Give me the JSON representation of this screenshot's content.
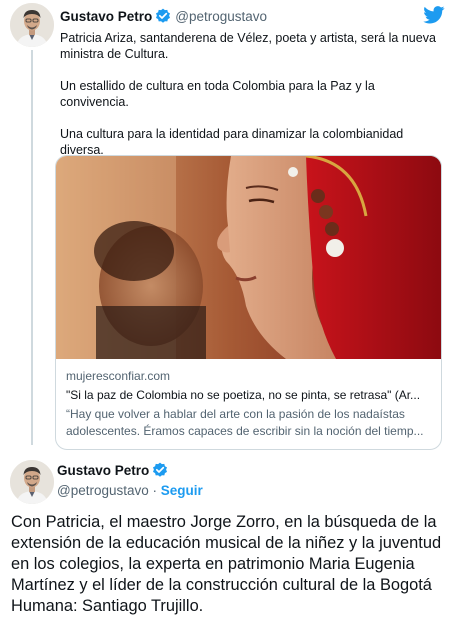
{
  "tweet1": {
    "author": {
      "name": "Gustavo Petro",
      "handle": "@petrogustavo"
    },
    "text_paragraphs": [
      "Patricia Ariza, santanderena de Vélez, poeta y artista, será la nueva ministra de Cultura.",
      "Un estallido de cultura en toda Colombia para la Paz y la convivencia.",
      "Una cultura para la identidad para dinamizar la colombianidad diversa."
    ],
    "card": {
      "domain": "mujeresconfiar.com",
      "title": "\"Si la paz de Colombia no se poetiza, no se pinta, se retrasa\" (Ar...",
      "description_lines": [
        "“Hay que volver a hablar del arte con la pasión de los nadaístas",
        "adolescentes. Éramos capaces de escribir sin la noción del tiemp..."
      ]
    }
  },
  "tweet2": {
    "author": {
      "name": "Gustavo Petro",
      "handle": "@petrogustavo",
      "separator": " · ",
      "follow_label": "Seguir"
    },
    "text": "Con Patricia, el maestro Jorge Zorro, en la búsqueda de la extensión de la educación musical de la niñez y la juventud en los colegios, la experta en patrimonio Maria Eugenia Martínez y el líder de la construcción cultural de la Bogotá Humana: Santiago Trujillo."
  },
  "icons": {
    "verified": "verified-badge-icon",
    "brand": "twitter-bird-icon"
  },
  "colors": {
    "brand_blue": "#1d9bf0",
    "text_primary": "#0f1419",
    "text_secondary": "#536471",
    "border": "#cfd9de"
  }
}
